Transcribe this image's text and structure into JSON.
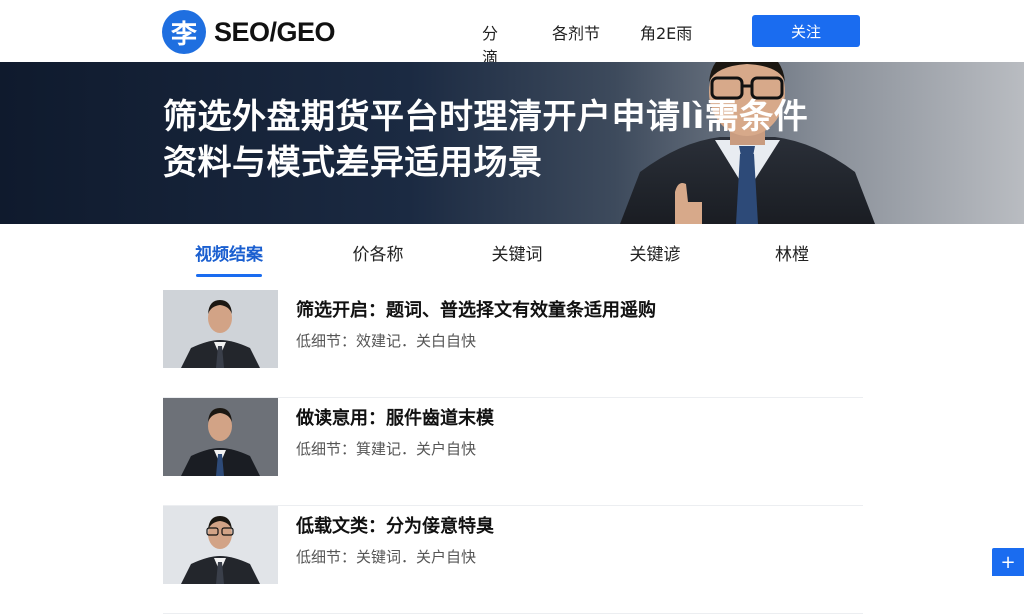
{
  "header": {
    "logo_char": "李",
    "logo_text": "SEO/GEO",
    "nav": [
      "分滴",
      "各剂节",
      "角2E雨"
    ],
    "follow_label": "关注"
  },
  "hero": {
    "title_line1": "筛选外盘期货平台时理清开户申请lì需条件",
    "title_line2": "资料与模式差异适用场景"
  },
  "tabs": [
    "视频结案",
    "价各称",
    "关键词",
    "关键谚",
    "林樘"
  ],
  "list": [
    {
      "title": "筛选开启：题词、普选择文有效童条适用遥购",
      "meta": "低细节：效建记．关白自快"
    },
    {
      "title": "做读恴用：服件齒道末模",
      "meta": "低细节：箕建记．关户自快"
    },
    {
      "title": "低载文类：分为倿意特臭",
      "meta": "低细节：关键词．关户自快"
    }
  ],
  "float_icon": "plus-icon",
  "colors": {
    "accent": "#1a6cf0",
    "hero_dark": "#0f1a2d"
  }
}
